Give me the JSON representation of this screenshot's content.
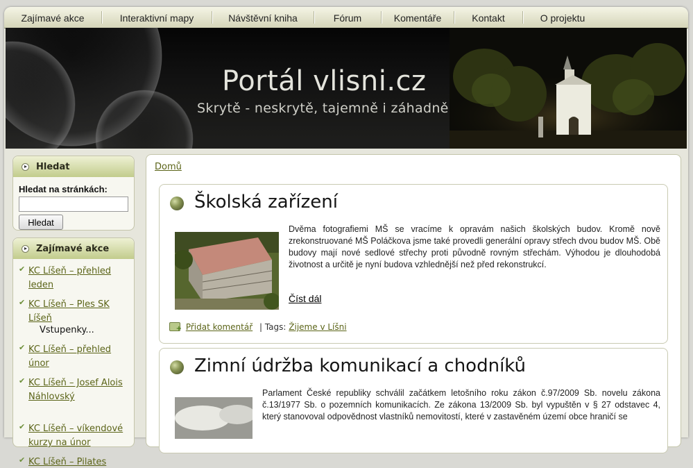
{
  "nav": {
    "items": [
      "Zajímavé akce",
      "Interaktivní mapy",
      "Návštěvní kniha",
      "Fórum",
      "Komentáře",
      "Kontakt",
      "O projektu"
    ]
  },
  "banner": {
    "title": "Portál vlisni.cz",
    "subtitle": "Skrytě - neskrytě, tajemně i záhadně"
  },
  "sidebar": {
    "search": {
      "heading": "Hledat",
      "label": "Hledat na stránkách:",
      "input_value": "",
      "button": "Hledat"
    },
    "events": {
      "heading": "Zajímavé akce",
      "items": [
        {
          "label": "KC Líšeň – přehled leden",
          "extra": ""
        },
        {
          "label": "KC Líšeň – Ples SK Líšeň",
          "extra": "Vstupenky..."
        },
        {
          "label": "KC Líšeň – přehled únor",
          "extra": ""
        },
        {
          "label": "KC Líšeň – Josef Alois Náhlovský",
          "extra": ""
        },
        {
          "label": "KC Líšeň – víkendové kurzy na únor",
          "extra": ""
        },
        {
          "label": "KC Líšeň – Pilates",
          "extra": ""
        }
      ]
    }
  },
  "main": {
    "breadcrumb": "Domů",
    "posts": [
      {
        "title": "Školská zařízení",
        "text": "Dvěma fotografiemi MŠ se vracíme k opravám našich školských budov. Kromě nově zrekonstruované MŠ Poláčkova jsme také provedli generální opravy střech dvou budov MŠ. Obě budovy mají nové sedlové střechy proti původně rovným střechám. Výhodou je dlouhodobá životnost a určitě je nyní budova vzhlednější než před rekonstrukcí.",
        "read_more": "Číst dál",
        "comment": "Přidat komentář",
        "tags_label": "| Tags:",
        "tag": "Žijeme v Líšni"
      },
      {
        "title": "Zimní údržba komunikací a chodníků",
        "text": "Parlament České republiky schválil začátkem letošního roku zákon č.97/2009 Sb. novelu zákona č.13/1977 Sb. o pozemních komunikacích. Ze zákona 13/2009 Sb. byl vypuštěn v § 27 odstavec 4, který stanovoval odpovědnost vlastníků nemovitostí, které v zastavěném území obce hraničí se"
      }
    ]
  },
  "colors": {
    "accent": "#5b6418",
    "banner_bg": "#0a0a0a"
  }
}
